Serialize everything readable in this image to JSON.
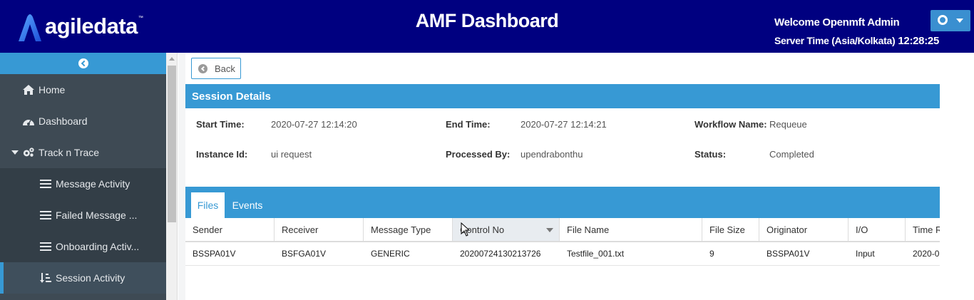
{
  "header": {
    "logo_text": "agiledata",
    "logo_tm": "™",
    "title": "AMF Dashboard",
    "welcome": "Welcome Openmft Admin",
    "server_time_label": "Server Time (Asia/Kolkata)",
    "server_time_value": "12:28:25",
    "brand_color": "#000080",
    "accent_color": "#3799d4"
  },
  "sidebar": {
    "toggle_icon": "chevron-left-circle-icon",
    "items": [
      {
        "label": "Home",
        "icon": "home-icon"
      },
      {
        "label": "Dashboard",
        "icon": "dashboard-gauge-icon"
      },
      {
        "label": "Track n Trace",
        "icon": "gears-icon",
        "expanded": true
      },
      {
        "label": "Message Activity",
        "icon": "list-icon"
      },
      {
        "label": "Failed Message ...",
        "icon": "list-icon"
      },
      {
        "label": "Onboarding Activ...",
        "icon": "list-icon"
      },
      {
        "label": "Session Activity",
        "icon": "sort-list-icon",
        "active": true
      }
    ]
  },
  "back_button": {
    "label": "Back",
    "icon": "arrow-left-circle-icon"
  },
  "session_details": {
    "title": "Session Details",
    "start_time_label": "Start Time:",
    "start_time": "2020-07-27 12:14:20",
    "end_time_label": "End Time:",
    "end_time": "2020-07-27 12:14:21",
    "workflow_name_label": "Workflow Name:",
    "workflow_name": "Requeue",
    "instance_id_label": "Instance Id:",
    "instance_id": "ui request",
    "processed_by_label": "Processed By:",
    "processed_by": "upendrabonthu",
    "status_label": "Status:",
    "status": "Completed"
  },
  "tabs": [
    {
      "label": "Files",
      "active": true
    },
    {
      "label": "Events",
      "active": false
    }
  ],
  "files_table": {
    "columns": [
      "Sender",
      "Receiver",
      "Message Type",
      "Control No",
      "File Name",
      "File Size",
      "Originator",
      "I/O",
      "Time R"
    ],
    "rows": [
      [
        "BSSPA01V",
        "BSFGA01V",
        "GENERIC",
        "20200724130213726",
        "Testfile_001.txt",
        "9",
        "BSSPA01V",
        "Input",
        "2020-0"
      ]
    ]
  }
}
